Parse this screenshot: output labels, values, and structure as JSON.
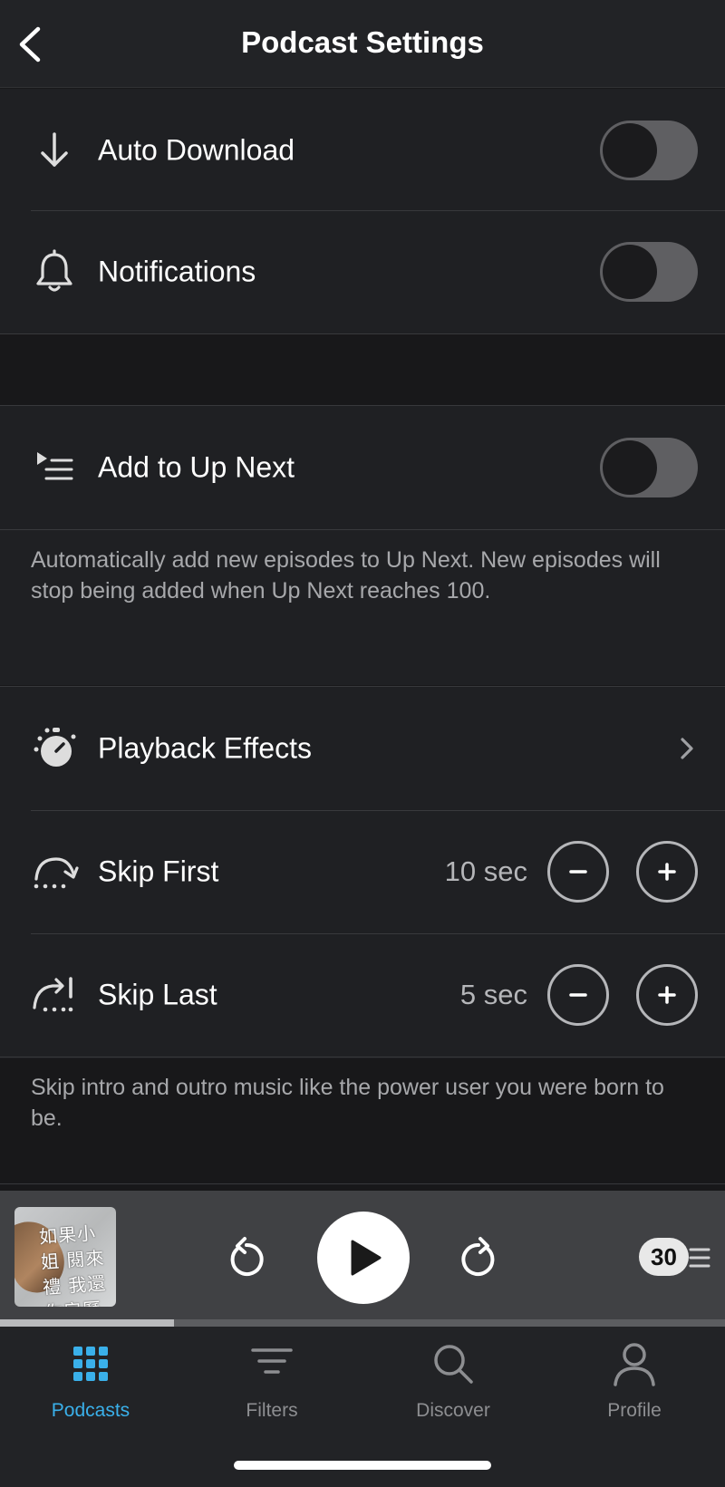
{
  "header": {
    "title": "Podcast Settings"
  },
  "settings": {
    "auto_download": {
      "label": "Auto Download",
      "enabled": false
    },
    "notifications": {
      "label": "Notifications",
      "enabled": false
    },
    "add_up_next": {
      "label": "Add to Up Next",
      "enabled": false
    },
    "up_next_description": "Automatically add new episodes to Up Next. New episodes will stop being added when Up Next reaches 100.",
    "playback_effects": {
      "label": "Playback Effects"
    },
    "skip_first": {
      "label": "Skip First",
      "value": "10 sec"
    },
    "skip_last": {
      "label": "Skip Last",
      "value": "5 sec"
    },
    "skip_description": "Skip intro and outro music like the power user you were born to be."
  },
  "player": {
    "artwork_text": "如果小姐 閱來禮 我還你房歷",
    "speed": "30",
    "progress": 0.24
  },
  "tabs": [
    {
      "label": "Podcasts",
      "icon": "grid-icon",
      "active": true
    },
    {
      "label": "Filters",
      "icon": "filter-icon",
      "active": false
    },
    {
      "label": "Discover",
      "icon": "search-icon",
      "active": false
    },
    {
      "label": "Profile",
      "icon": "person-icon",
      "active": false
    }
  ],
  "colors": {
    "accent": "#3ab0ea",
    "background": "#18181a",
    "surface": "#1f2023"
  }
}
